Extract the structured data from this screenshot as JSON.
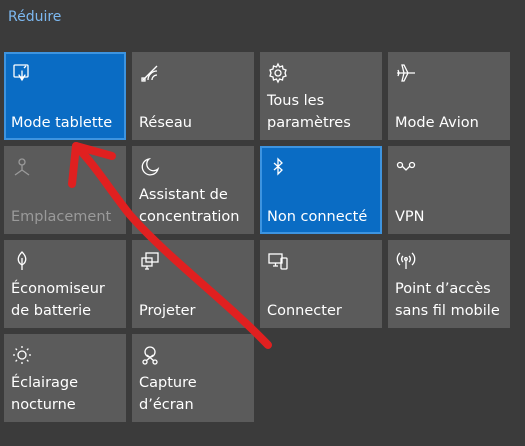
{
  "header": {
    "collapse_label": "Réduire"
  },
  "tiles": [
    {
      "label": "Mode tablette",
      "icon": "tablet-mode-icon",
      "state": "active"
    },
    {
      "label": "Réseau",
      "icon": "network-icon",
      "state": "normal"
    },
    {
      "label": "Tous les paramètres",
      "icon": "gear-icon",
      "state": "normal"
    },
    {
      "label": "Mode Avion",
      "icon": "airplane-icon",
      "state": "normal"
    },
    {
      "label": "Emplacement",
      "icon": "location-icon",
      "state": "disabled"
    },
    {
      "label": "Assistant de concentration",
      "icon": "moon-icon",
      "state": "normal"
    },
    {
      "label": "Non connecté",
      "icon": "bluetooth-icon",
      "state": "active"
    },
    {
      "label": "VPN",
      "icon": "vpn-icon",
      "state": "normal"
    },
    {
      "label": "Économiseur de batterie",
      "icon": "battery-saver-icon",
      "state": "normal"
    },
    {
      "label": "Projeter",
      "icon": "project-icon",
      "state": "normal"
    },
    {
      "label": "Connecter",
      "icon": "connect-icon",
      "state": "normal"
    },
    {
      "label": "Point d’accès sans fil mobile",
      "icon": "mobile-hotspot-icon",
      "state": "normal"
    },
    {
      "label": "Éclairage nocturne",
      "icon": "night-light-icon",
      "state": "normal"
    },
    {
      "label": "Capture d’écran",
      "icon": "screen-snip-icon",
      "state": "normal"
    }
  ],
  "colors": {
    "background": "#3b3b3b",
    "tile": "#5b5b5b",
    "tile_active": "#0a6cc4",
    "link": "#7cb8f0",
    "annotation_arrow": "#e02020"
  }
}
